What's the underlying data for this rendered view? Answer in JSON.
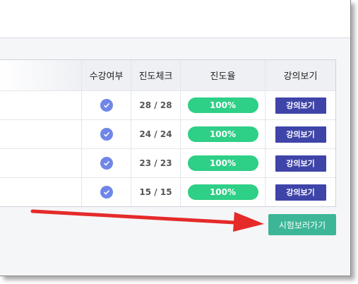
{
  "table": {
    "headers": [
      "",
      "수강여부",
      "진도체크",
      "진도율",
      "강의보기"
    ],
    "rows": [
      {
        "progress_check": "28 / 28",
        "rate": "100%",
        "view_label": "강의보기"
      },
      {
        "progress_check": "24 / 24",
        "rate": "100%",
        "view_label": "강의보기"
      },
      {
        "progress_check": "23 / 23",
        "rate": "100%",
        "view_label": "강의보기"
      },
      {
        "progress_check": "15 / 15",
        "rate": "100%",
        "view_label": "강의보기"
      }
    ]
  },
  "exam_button_label": "시험보러가기",
  "colors": {
    "check": "#6f86e8",
    "progress_bar": "#2ecf86",
    "view_button": "#3e44a8",
    "exam_button": "#3db697",
    "arrow": "#e52a2a"
  },
  "icons": {
    "completed": "check-circle-icon",
    "annotation": "red-arrow-icon"
  }
}
